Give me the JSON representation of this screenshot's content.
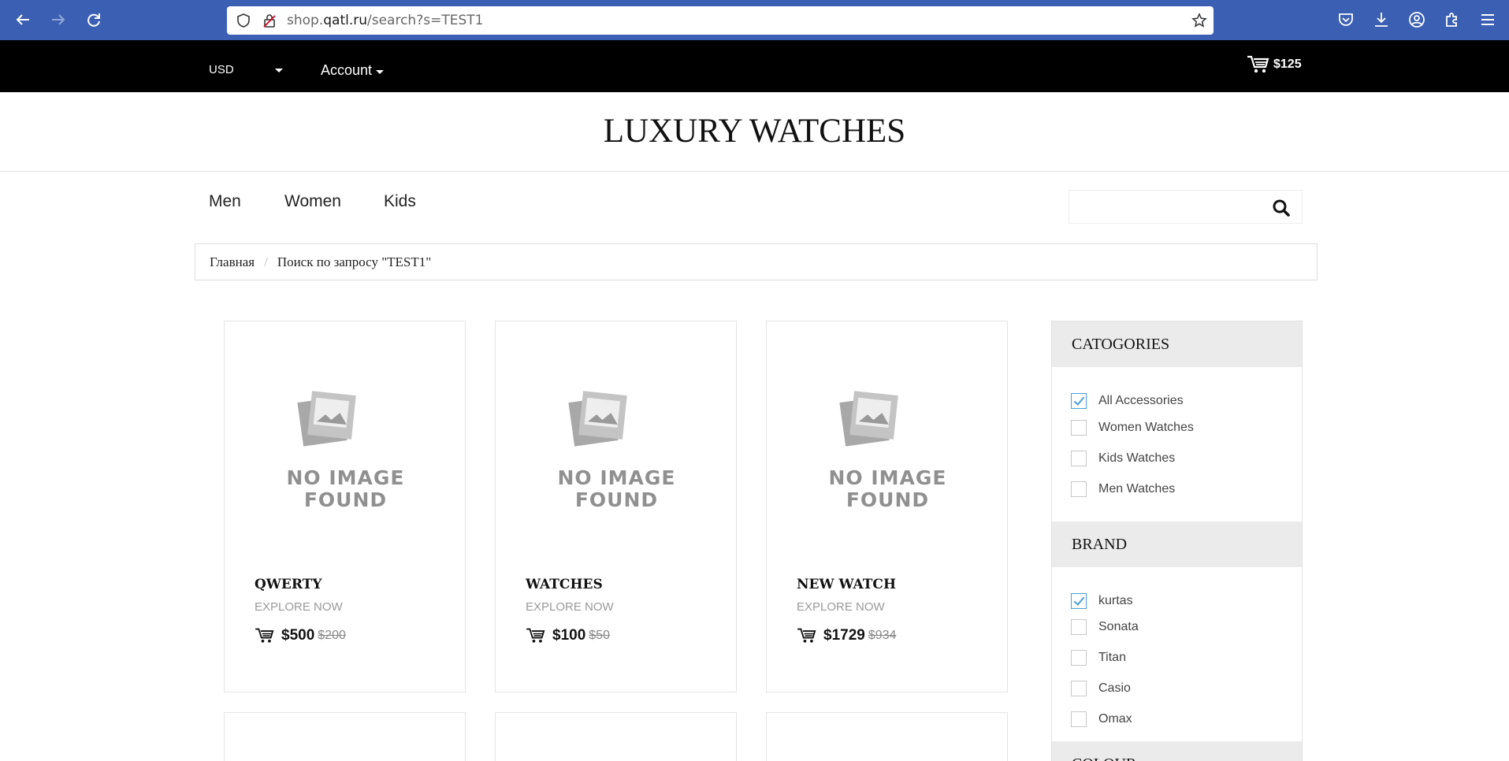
{
  "browser": {
    "url_prefix": "shop.",
    "url_host": "qatl.ru",
    "url_path": "/search?s=TEST1"
  },
  "topbar": {
    "currency": "USD",
    "account_label": "Account",
    "cart_total": "$125"
  },
  "site": {
    "title": "LUXURY WATCHES"
  },
  "nav": {
    "items": [
      "Men",
      "Women",
      "Kids"
    ],
    "search_placeholder": ""
  },
  "breadcrumb": {
    "home": "Главная",
    "current": "Поиск по запросу \"TEST1\""
  },
  "products": [
    {
      "name": "QWERTY",
      "explore": "EXPLORE NOW",
      "price": "$500",
      "old_price": "$200",
      "placeholder_line1": "NO IMAGE",
      "placeholder_line2": "FOUND"
    },
    {
      "name": "WATCHES",
      "explore": "EXPLORE NOW",
      "price": "$100",
      "old_price": "$50",
      "placeholder_line1": "NO IMAGE",
      "placeholder_line2": "FOUND"
    },
    {
      "name": "NEW WATCH",
      "explore": "EXPLORE NOW",
      "price": "$1729",
      "old_price": "$934",
      "placeholder_line1": "NO IMAGE",
      "placeholder_line2": "FOUND"
    }
  ],
  "sidebar": {
    "categories_title": "CATOGORIES",
    "categories": [
      {
        "label": "All Accessories",
        "checked": true
      },
      {
        "label": "Women Watches",
        "checked": false
      },
      {
        "label": "Kids Watches",
        "checked": false
      },
      {
        "label": "Men Watches",
        "checked": false
      }
    ],
    "brand_title": "BRAND",
    "brands": [
      {
        "label": "kurtas",
        "checked": true
      },
      {
        "label": "Sonata",
        "checked": false
      },
      {
        "label": "Titan",
        "checked": false
      },
      {
        "label": "Casio",
        "checked": false
      },
      {
        "label": "Omax",
        "checked": false
      }
    ],
    "colour_title": "COLOUR"
  },
  "colors": {
    "browser_bar": "#3b5fb3",
    "topbar": "#000000",
    "checkbox_accent": "#4a9fd8"
  }
}
